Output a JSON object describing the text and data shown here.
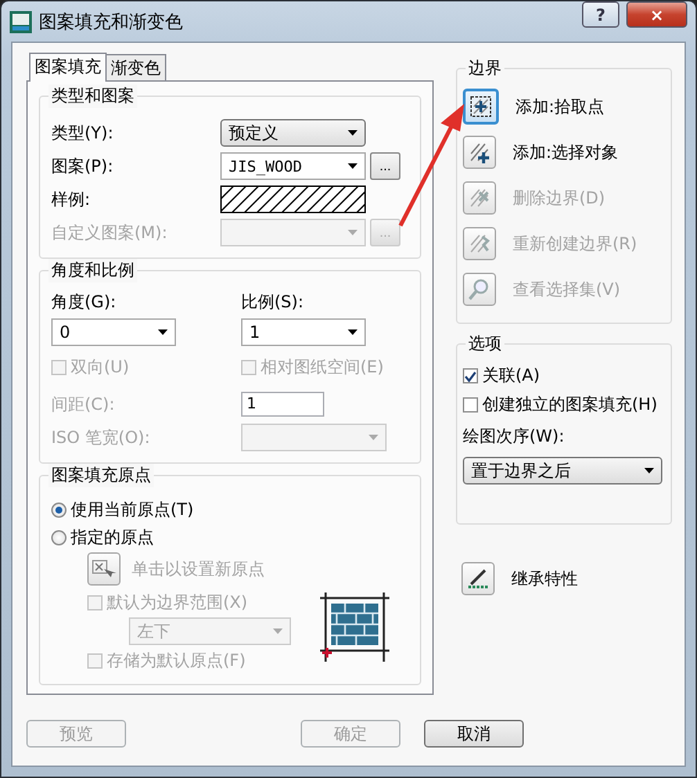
{
  "window": {
    "title": "图案填充和渐变色",
    "help_button": "?",
    "close_button": "×"
  },
  "tabs": [
    {
      "label": "图案填充",
      "selected": true
    },
    {
      "label": "渐变色",
      "selected": false
    }
  ],
  "type_and_pattern": {
    "title": "类型和图案",
    "rows": [
      {
        "kind": "combo",
        "label": "类型(Y):",
        "value": "预定义",
        "disabled": false
      },
      {
        "kind": "combo",
        "label": "图案(P):",
        "value": "JIS_WOOD",
        "disabled": false,
        "browse": "..."
      },
      {
        "kind": "swatch",
        "label": "样例:"
      },
      {
        "kind": "combo",
        "label": "自定义图案(M):",
        "disabled": true,
        "browse": "..."
      }
    ]
  },
  "angle_and_scale": {
    "title": "角度和比例",
    "angle": {
      "label": "角度(G):",
      "value": "0"
    },
    "scale": {
      "label": "比例(S):",
      "value": "1"
    },
    "checks": [
      {
        "label": "双向(U)",
        "checked": false,
        "disabled": true
      },
      {
        "label": "相对图纸空间(E)",
        "checked": false,
        "disabled": true
      }
    ],
    "spacing": {
      "label": "间距(C):",
      "value": "1",
      "disabled": true
    },
    "iso_pen_width": {
      "label": "ISO 笔宽(O):",
      "disabled": true
    }
  },
  "origin": {
    "title": "图案填充原点",
    "radios": [
      {
        "label": "使用当前原点(T)",
        "selected": true
      },
      {
        "label": "指定的原点",
        "selected": false
      }
    ],
    "set_button": {
      "label": "单击以设置新原点",
      "disabled": true
    },
    "default_extent": {
      "label": "默认为边界范围(X)",
      "checked": false,
      "disabled": true
    },
    "position": {
      "value": "左下",
      "disabled": true
    },
    "store_default": {
      "label": "存储为默认原点(F)",
      "checked": false,
      "disabled": true
    }
  },
  "boundaries": {
    "title": "边界",
    "buttons": [
      {
        "kind": "pick",
        "label": "添加:拾取点",
        "disabled": false
      },
      {
        "kind": "select",
        "label": "添加:选择对象",
        "disabled": false
      },
      {
        "kind": "remove",
        "label": "删除边界(D)",
        "disabled": true
      },
      {
        "kind": "recreate",
        "label": "重新创建边界(R)",
        "disabled": true
      },
      {
        "kind": "view",
        "label": "查看选择集(V)",
        "disabled": true
      }
    ]
  },
  "options": {
    "title": "选项",
    "checks": [
      {
        "label": "关联(A)",
        "checked": true,
        "disabled": false
      },
      {
        "label": "创建独立的图案填充(H)",
        "checked": false,
        "disabled": false
      }
    ],
    "draw_order": {
      "label": "绘图次序(W):",
      "value": "置于边界之后"
    }
  },
  "inherit": {
    "label": "继承特性"
  },
  "buttons": [
    {
      "label": "预览",
      "disabled": true
    },
    {
      "label": "确定",
      "disabled": true
    },
    {
      "label": "取消",
      "disabled": false
    }
  ]
}
